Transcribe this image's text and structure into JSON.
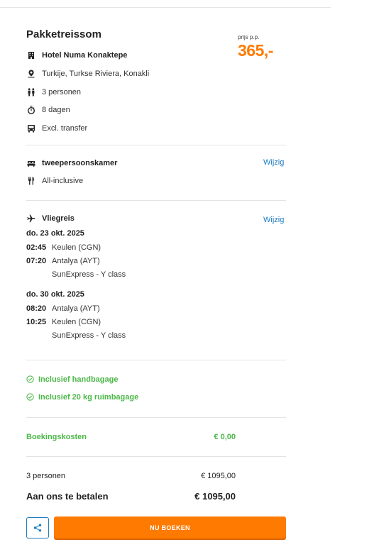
{
  "summary": {
    "title": "Pakketreissom",
    "price_label": "prijs p.p.",
    "price": "365,-",
    "hotel": "Hotel Numa Konaktepe",
    "location": "Turkije, Turkse Riviera, Konakli",
    "persons": "3 personen",
    "duration": "8 dagen",
    "transfer": "Excl. transfer"
  },
  "room": {
    "type": "tweepersoonskamer",
    "board": "All-inclusive",
    "change_label": "Wijzig"
  },
  "flight": {
    "label": "Vliegreis",
    "change_label": "Wijzig",
    "outbound": {
      "date": "do. 23 okt. 2025",
      "dep_time": "02:45",
      "dep_place": "Keulen (CGN)",
      "arr_time": "07:20",
      "arr_place": "Antalya (AYT)",
      "carrier": "SunExpress - Y class"
    },
    "return": {
      "date": "do. 30 okt. 2025",
      "dep_time": "08:20",
      "dep_place": "Antalya (AYT)",
      "arr_time": "10:25",
      "arr_place": "Keulen (CGN)",
      "carrier": "SunExpress - Y class"
    }
  },
  "baggage": {
    "hand": "Inclusief handbagage",
    "hold": "Inclusief 20 kg ruimbagage"
  },
  "costs": {
    "booking_label": "Boekingskosten",
    "booking_value": "€ 0,00",
    "persons_label": "3 personen",
    "persons_value": "€ 1095,00",
    "total_label": "Aan ons te betalen",
    "total_value": "€ 1095,00"
  },
  "actions": {
    "book_label": "NU BOEKEN",
    "share_icon": "share-icon"
  },
  "colors": {
    "accent": "#ff7a00",
    "link": "#1d7bbf",
    "success": "#4cb848"
  }
}
